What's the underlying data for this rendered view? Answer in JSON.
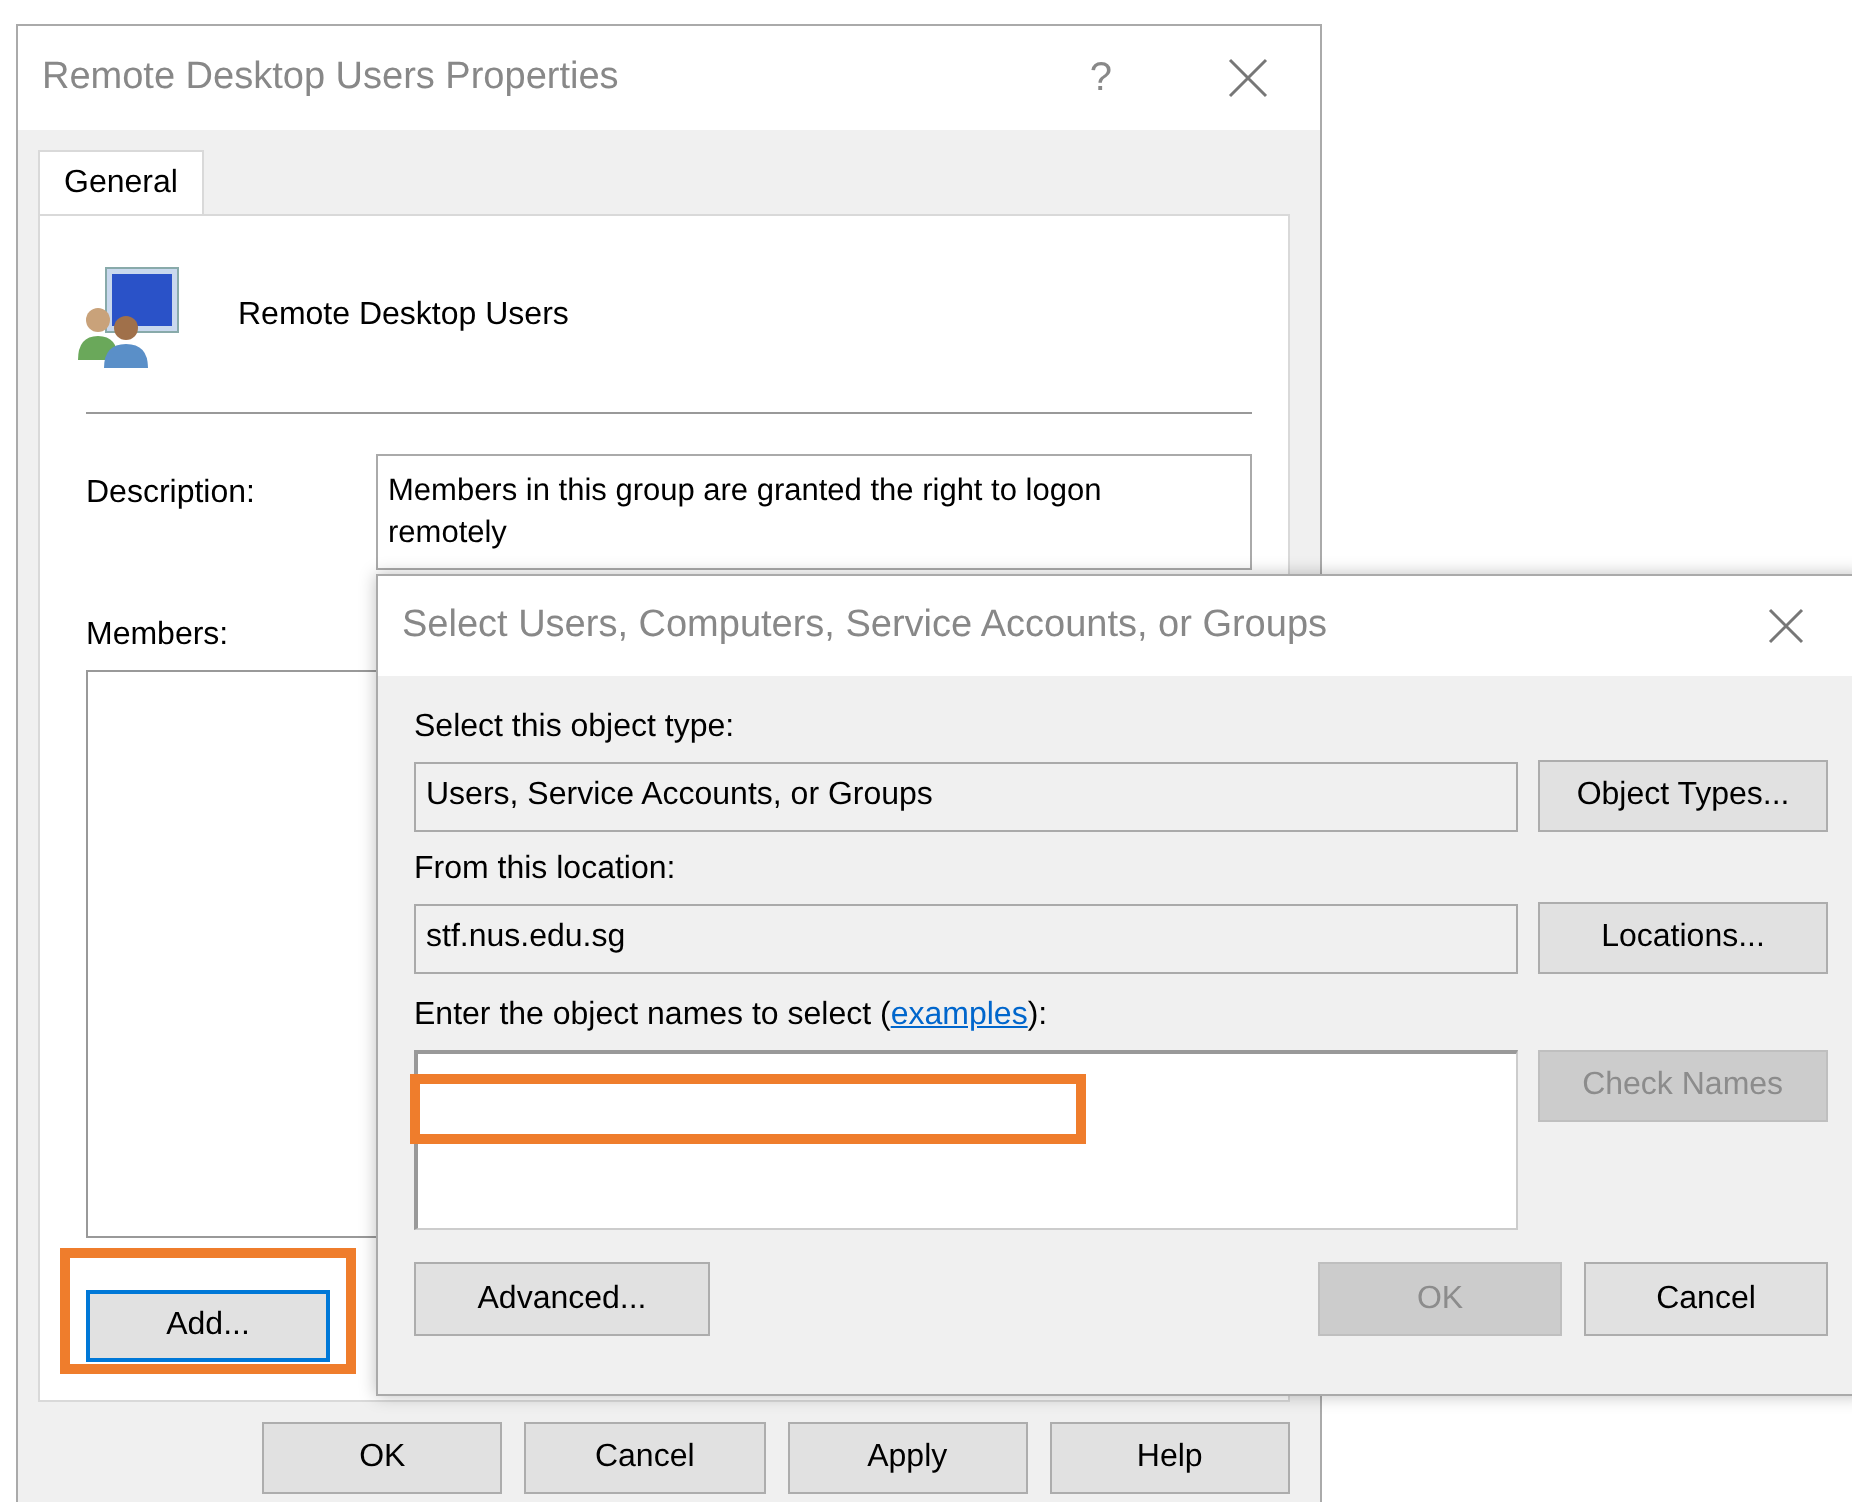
{
  "main_dialog": {
    "title": "Remote Desktop Users Properties",
    "help_glyph": "?",
    "tabs": [
      {
        "label": "General",
        "selected": true
      }
    ],
    "group_name": "Remote Desktop Users",
    "description_label": "Description:",
    "description": "Members in this group are granted the right to logon remotely",
    "members_label": "Members:",
    "add_button": {
      "label": "Add...",
      "focused": true,
      "highlighted": true
    },
    "buttons": [
      {
        "label": "OK"
      },
      {
        "label": "Cancel"
      },
      {
        "label": "Apply"
      },
      {
        "label": "Help"
      }
    ]
  },
  "select_dialog": {
    "title": "Select Users, Computers, Service Accounts, or Groups",
    "object_type_label": "Select this object type:",
    "object_type": "Users, Service Accounts, or Groups",
    "object_types_button": "Object Types...",
    "location_label": "From this location:",
    "location": "stf.nus.edu.sg",
    "locations_button": "Locations...",
    "names_prompt_before": "Enter the object names to select (",
    "names_link": "examples",
    "names_prompt_after": "):",
    "names_field": {
      "highlighted": true
    },
    "check_names_button": {
      "label": "Check Names",
      "disabled": true
    },
    "advanced_button": "Advanced...",
    "buttons": [
      {
        "label": "OK",
        "disabled": true
      },
      {
        "label": "Cancel",
        "disabled": false
      }
    ]
  }
}
